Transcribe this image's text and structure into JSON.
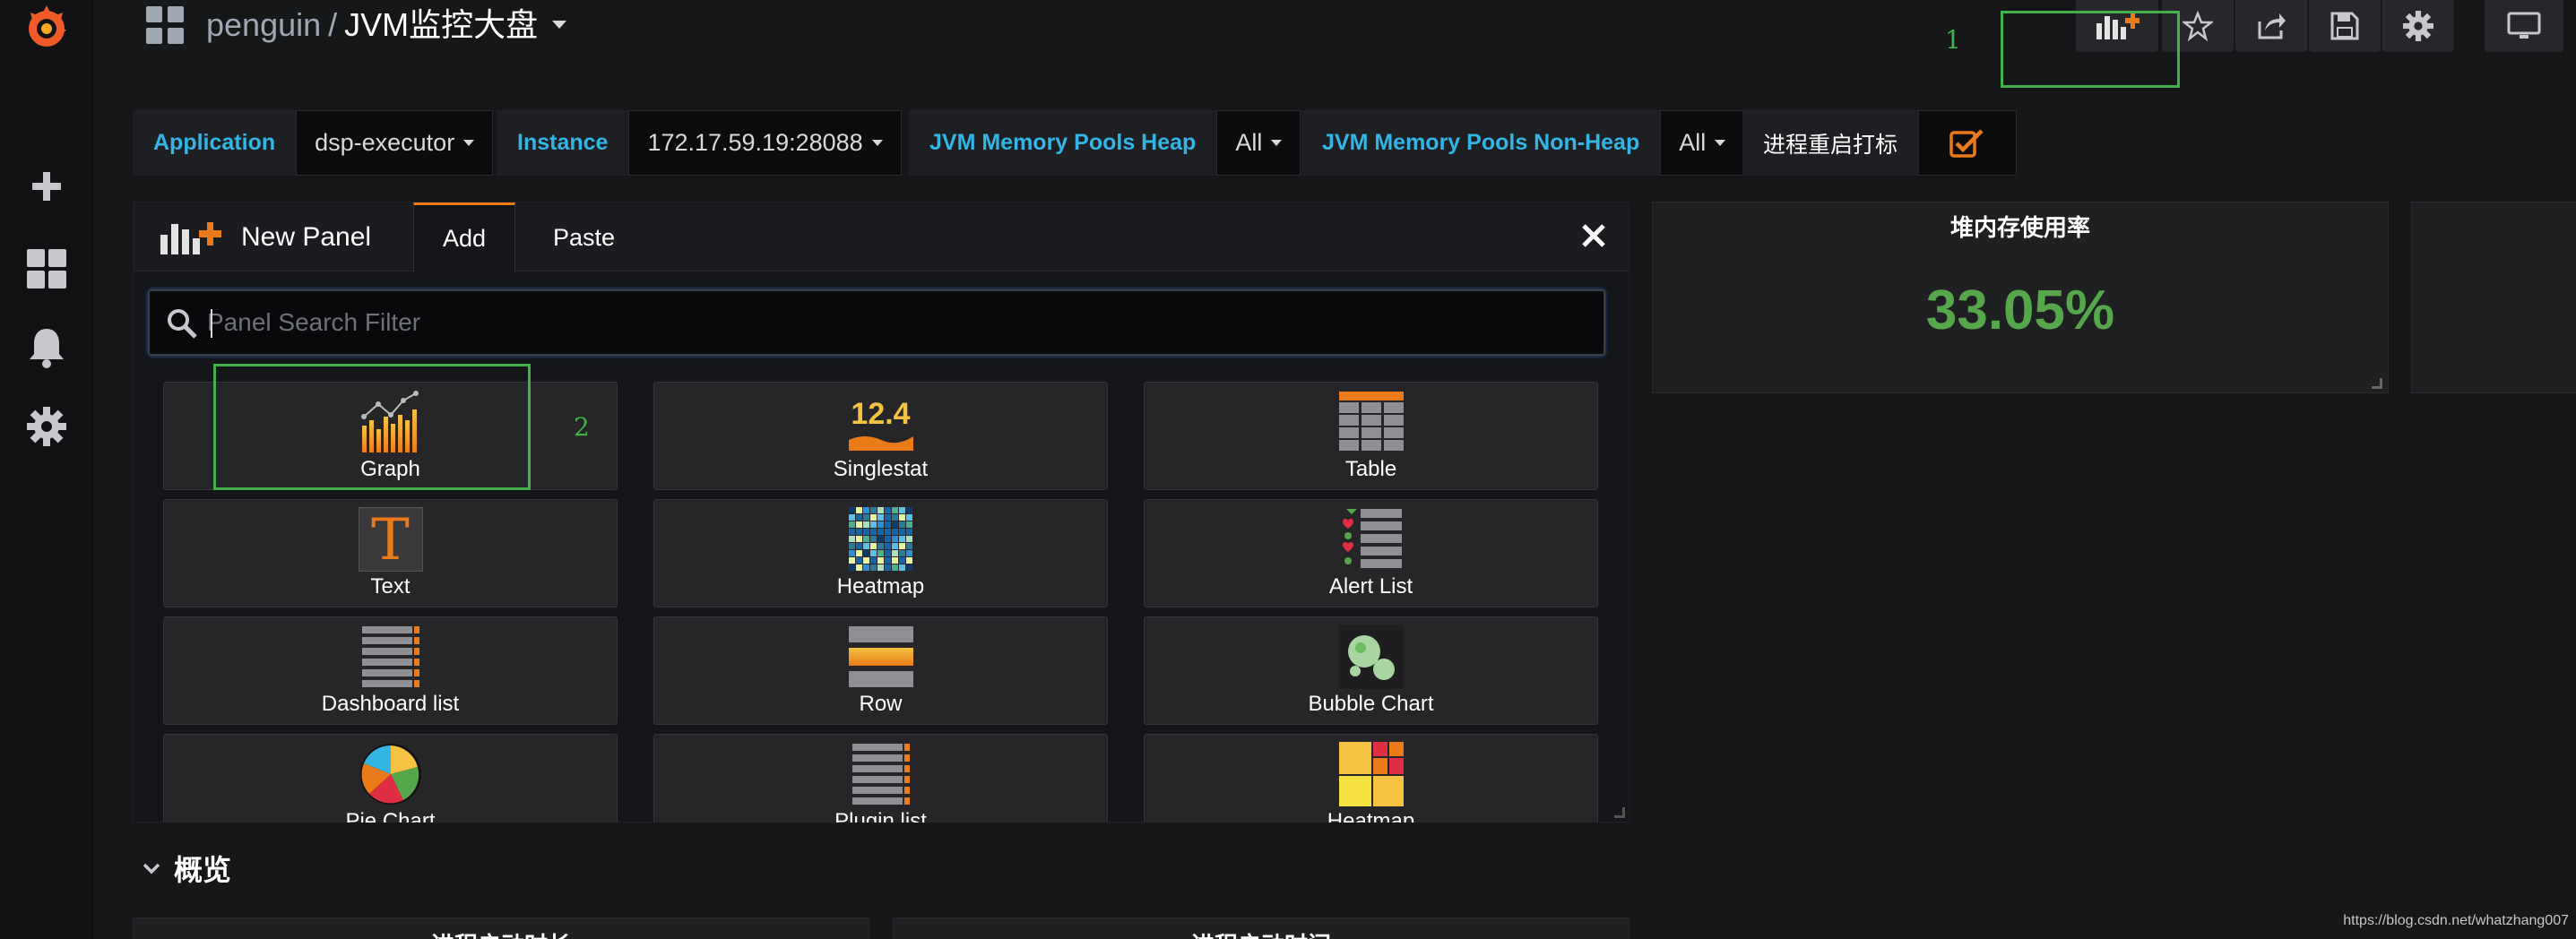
{
  "sidebar": {
    "items": [
      {
        "icon": "grafana-logo-icon"
      },
      {
        "icon": "plus-icon"
      },
      {
        "icon": "dashboards-icon"
      },
      {
        "icon": "bell-icon"
      },
      {
        "icon": "gear-icon"
      }
    ]
  },
  "header": {
    "folder": "penguin",
    "separator": "/",
    "title": "JVM监控大盘"
  },
  "annotations": {
    "one": "1",
    "two": "2"
  },
  "variables": {
    "application": {
      "label": "Application",
      "value": "dsp-executor"
    },
    "instance": {
      "label": "Instance",
      "value": "172.17.59.19:28088"
    },
    "heap": {
      "label": "JVM Memory Pools Heap",
      "value": "All"
    },
    "nonheap": {
      "label": "JVM Memory Pools Non-Heap",
      "value": "All"
    },
    "restart": {
      "label": "进程重启打标"
    }
  },
  "add_panel": {
    "title": "New Panel",
    "tabs": {
      "add": "Add",
      "paste": "Paste"
    },
    "search_placeholder": "Panel Search Filter",
    "singlestat_sample": "12.4",
    "text_glyph": "T",
    "items": [
      {
        "label": "Graph"
      },
      {
        "label": "Singlestat"
      },
      {
        "label": "Table"
      },
      {
        "label": "Text"
      },
      {
        "label": "Heatmap"
      },
      {
        "label": "Alert List"
      },
      {
        "label": "Dashboard list"
      },
      {
        "label": "Row"
      },
      {
        "label": "Bubble Chart"
      },
      {
        "label": "Pie Chart"
      },
      {
        "label": "Plugin list"
      },
      {
        "label": "Heatmap"
      }
    ]
  },
  "stat_panel": {
    "title": "堆内存使用率",
    "value": "33.05%"
  },
  "row": {
    "title": "概览"
  },
  "bottom_panels": [
    {
      "title": "进程启动时长"
    },
    {
      "title": "进程启动时间"
    }
  ],
  "watermark": "https://blog.csdn.net/whatzhang007",
  "colors": {
    "accent_orange": "#eb7b18",
    "stat_green": "#56a64b",
    "variable_blue": "#33b5e5",
    "annotation_green": "#3fb349"
  }
}
